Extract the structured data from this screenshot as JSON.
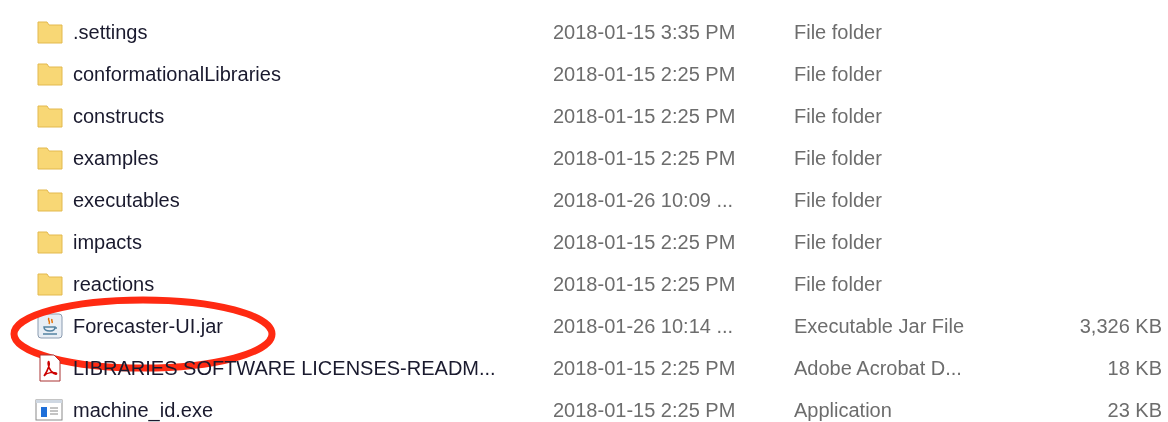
{
  "files": [
    {
      "kind": "folder",
      "name": ".settings",
      "modified": "2018-01-15 3:35 PM",
      "type": "File folder",
      "circled": false
    },
    {
      "kind": "folder",
      "name": "conformationalLibraries",
      "modified": "2018-01-15 2:25 PM",
      "type": "File folder",
      "circled": false
    },
    {
      "kind": "folder",
      "name": "constructs",
      "modified": "2018-01-15 2:25 PM",
      "type": "File folder",
      "circled": false
    },
    {
      "kind": "folder",
      "name": "examples",
      "modified": "2018-01-15 2:25 PM",
      "type": "File folder",
      "circled": false
    },
    {
      "kind": "folder",
      "name": "executables",
      "modified": "2018-01-26 10:09 ...",
      "type": "File folder",
      "circled": false
    },
    {
      "kind": "folder",
      "name": "impacts",
      "modified": "2018-01-15 2:25 PM",
      "type": "File folder",
      "circled": false
    },
    {
      "kind": "folder",
      "name": "reactions",
      "modified": "2018-01-15 2:25 PM",
      "type": "File folder",
      "circled": false
    },
    {
      "kind": "jar",
      "name": "Forecaster-UI.jar",
      "modified": "2018-01-26 10:14 ...",
      "type": "Executable Jar File",
      "size": "3,326 KB",
      "circled": true
    },
    {
      "kind": "pdf",
      "name": "LIBRARIES SOFTWARE LICENSES-READM...",
      "modified": "2018-01-15 2:25 PM",
      "type": "Adobe Acrobat D...",
      "size": "18 KB",
      "circled": false
    },
    {
      "kind": "exe",
      "name": "machine_id.exe",
      "modified": "2018-01-15 2:25 PM",
      "type": "Application",
      "size": "23 KB",
      "circled": false
    }
  ]
}
